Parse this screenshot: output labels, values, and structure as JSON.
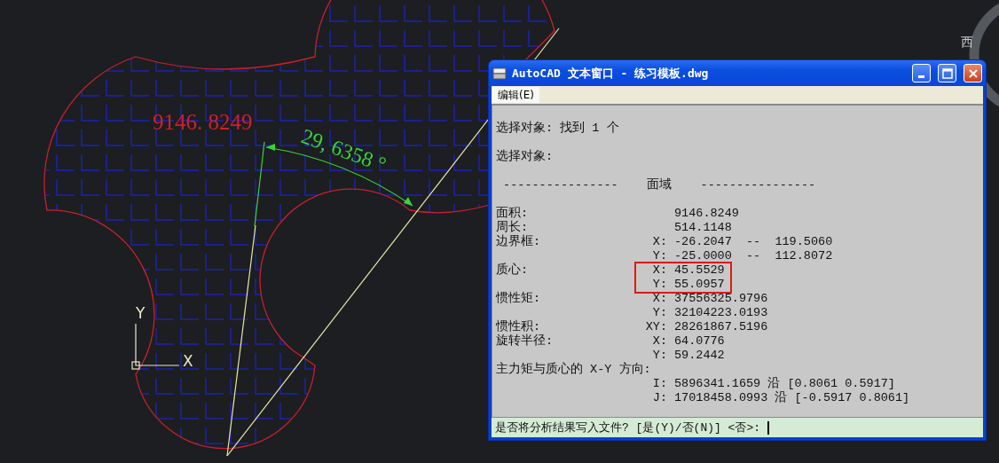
{
  "drawing": {
    "area_label": "9146. 8249",
    "angle_label": "29, 6358 °",
    "ucs_x": "X",
    "ucs_y": "Y"
  },
  "viewcube": {
    "label": "西"
  },
  "text_window": {
    "title": "AutoCAD 文本窗口 - 练习模板.dwg",
    "menu": [
      {
        "label": "编辑(E)",
        "selected": false
      }
    ],
    "lines": [
      {
        "kind": "text",
        "text": "选择对象: 找到 1 个"
      },
      {
        "kind": "blank"
      },
      {
        "kind": "text",
        "text": "选择对象:"
      },
      {
        "kind": "blank"
      },
      {
        "kind": "text",
        "text": " ----------------    面域    ----------------"
      },
      {
        "kind": "blank"
      },
      {
        "kind": "row",
        "label": "面积:",
        "value": "9146.8249"
      },
      {
        "kind": "row",
        "label": "周长:",
        "value": "514.1148"
      },
      {
        "kind": "row",
        "label": "边界框:",
        "axis": "X:",
        "value": "-26.2047  --  119.5060"
      },
      {
        "kind": "row",
        "axis": "Y:",
        "value": "-25.0000  --  112.8072"
      },
      {
        "kind": "group",
        "highlighted": true,
        "rows": [
          {
            "label": "质心:",
            "axis": "X:",
            "value": "45.5529"
          },
          {
            "axis": "Y:",
            "value": "55.0957"
          }
        ]
      },
      {
        "kind": "row",
        "label": "惯性矩:",
        "axis": "X:",
        "value": "37556325.9796"
      },
      {
        "kind": "row",
        "axis": "Y:",
        "value": "32104223.0193"
      },
      {
        "kind": "row",
        "label": "惯性积:",
        "axis": "XY:",
        "value": "28261867.5196"
      },
      {
        "kind": "row",
        "label": "旋转半径:",
        "axis": "X:",
        "value": "64.0776"
      },
      {
        "kind": "row",
        "axis": "Y:",
        "value": "59.2442"
      },
      {
        "kind": "text",
        "text": "主力矩与质心的 X-Y 方向:"
      },
      {
        "kind": "row",
        "axis": "I:",
        "value": "5896341.1659 沿 [0.8061 0.5917]"
      },
      {
        "kind": "row",
        "axis": "J:",
        "value": "17018458.0993 沿 [-0.5917 0.8061]"
      }
    ],
    "prompt": "是否将分析结果写入文件? [是(Y)/否(N)] <否>:"
  }
}
